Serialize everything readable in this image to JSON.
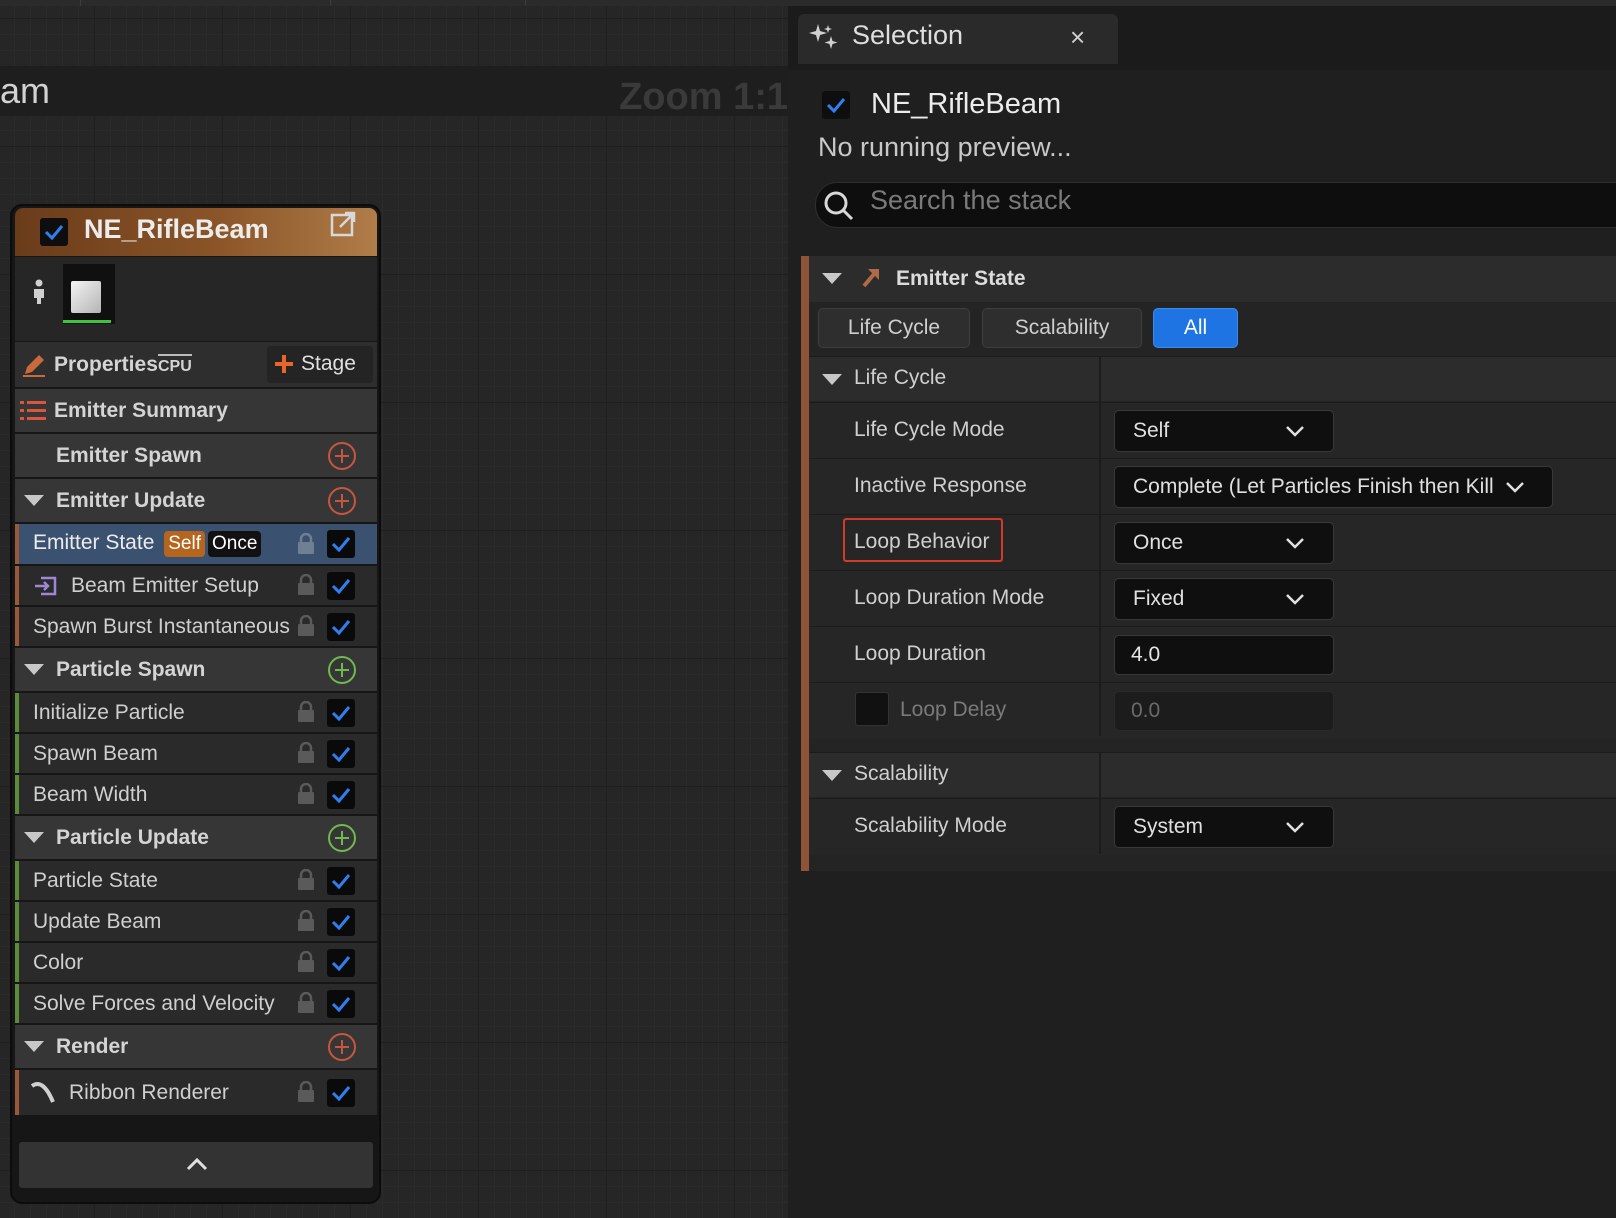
{
  "graph": {
    "title": "am",
    "zoom": "Zoom 1:1"
  },
  "node": {
    "title": "NE_RifleBeam",
    "properties_label": "Properties",
    "cpu_label": "CPU",
    "stage_label": "Stage",
    "summary_label": "Emitter Summary",
    "emitter_spawn": "Emitter Spawn",
    "emitter_update": "Emitter Update",
    "emitter_update_items": [
      {
        "label": "Emitter State",
        "badge1": "Self",
        "badge2": "Once",
        "selected": true
      },
      {
        "label": "Beam Emitter Setup"
      },
      {
        "label": "Spawn Burst Instantaneous"
      }
    ],
    "particle_spawn": "Particle Spawn",
    "particle_spawn_items": [
      "Initialize Particle",
      "Spawn Beam",
      "Beam Width"
    ],
    "particle_update": "Particle Update",
    "particle_update_items": [
      "Particle State",
      "Update Beam",
      "Color",
      "Solve Forces and Velocity"
    ],
    "render": "Render",
    "render_items": [
      "Ribbon Renderer"
    ]
  },
  "panel": {
    "tab_title": "Selection",
    "tab_close": "×",
    "system_name": "NE_RifleBeam",
    "preview_status": "No running preview...",
    "search_placeholder": "Search the stack",
    "emitter_state_title": "Emitter State",
    "filters": [
      "Life Cycle",
      "Scalability",
      "All"
    ],
    "active_filter": "All",
    "life_cycle_category": "Life Cycle",
    "life_cycle_mode_label": "Life Cycle Mode",
    "life_cycle_mode_value": "Self",
    "inactive_response_label": "Inactive Response",
    "inactive_response_value": "Complete (Let Particles Finish then Kill",
    "loop_behavior_label": "Loop Behavior",
    "loop_behavior_value": "Once",
    "loop_duration_mode_label": "Loop Duration Mode",
    "loop_duration_mode_value": "Fixed",
    "loop_duration_label": "Loop Duration",
    "loop_duration_value": "4.0",
    "loop_delay_label": "Loop Delay",
    "loop_delay_value": "0.0",
    "scalability_category": "Scalability",
    "scalability_mode_label": "Scalability Mode",
    "scalability_mode_value": "System"
  },
  "colors": {
    "accent_blue": "#1e74e3",
    "emitter_stripe": "#8f5437",
    "highlight_red": "#d23a2a",
    "add_red": "#c8553e",
    "add_green": "#6fb94f"
  }
}
